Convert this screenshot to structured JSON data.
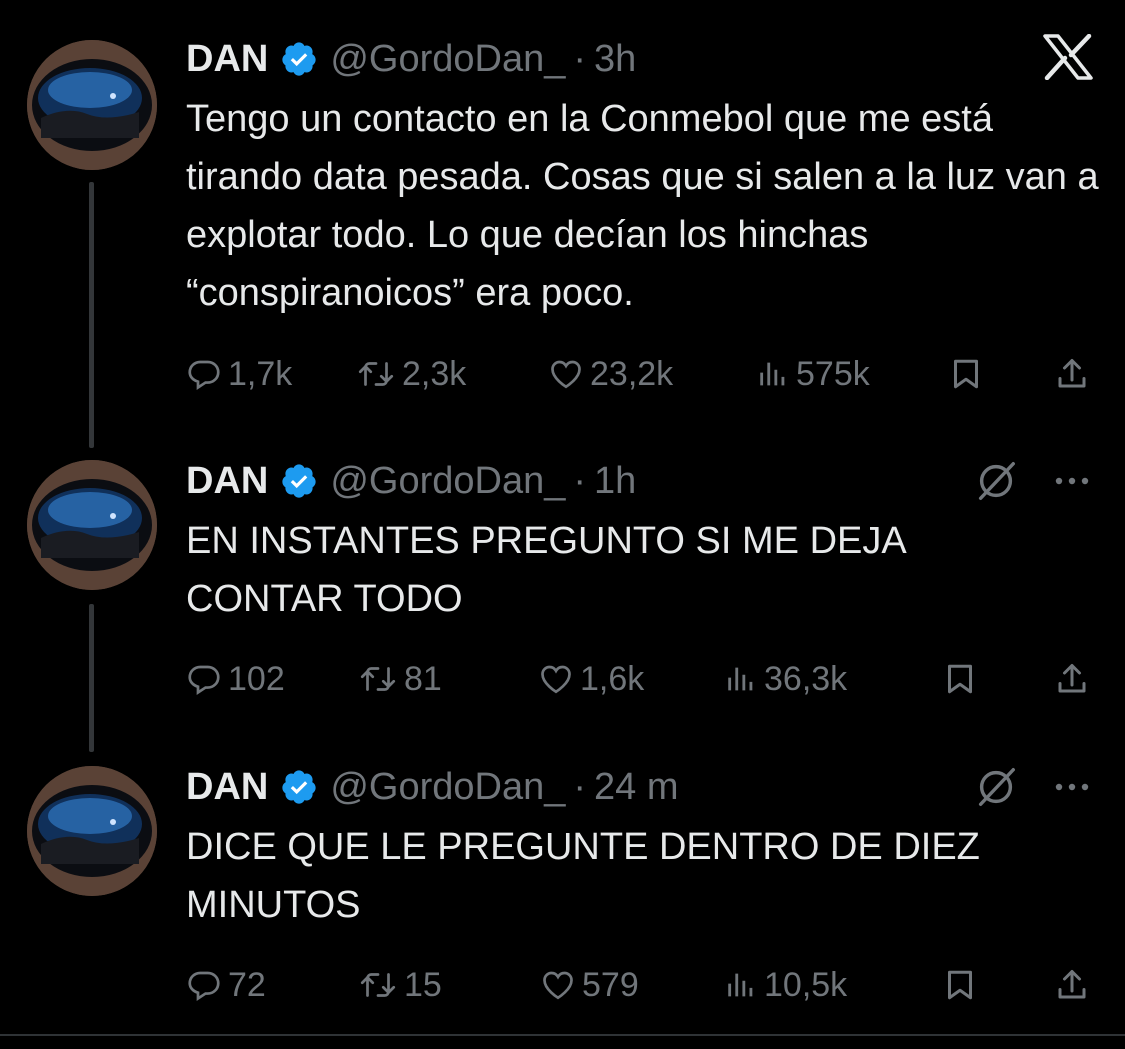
{
  "tweets": [
    {
      "name": "DAN",
      "handle": "@GordoDan_",
      "dot": "·",
      "time": "3h",
      "text": "Tengo un contacto en la Conmebol que me está tirando data pesada. Cosas que si salen a la luz van a explotar todo. Lo que decían los hinchas “conspiranoicos” era poco.",
      "replies": "1,7k",
      "retweets": "2,3k",
      "likes": "23,2k",
      "views": "575k"
    },
    {
      "name": "DAN",
      "handle": "@GordoDan_",
      "dot": "·",
      "time": "1h",
      "text": "EN INSTANTES PREGUNTO SI ME DEJA CONTAR TODO",
      "replies": "102",
      "retweets": "81",
      "likes": "1,6k",
      "views": "36,3k"
    },
    {
      "name": "DAN",
      "handle": "@GordoDan_",
      "dot": "·",
      "time": "24 m",
      "text": "DICE QUE LE PREGUNTE DENTRO DE DIEZ MINUTOS",
      "replies": "72",
      "retweets": "15",
      "likes": "579",
      "views": "10,5k"
    }
  ],
  "icons": {
    "brand": "x-logo-icon",
    "verified": "verified-badge-icon",
    "grok": "grok-icon",
    "more": "more-icon",
    "reply": "reply-icon",
    "retweet": "retweet-icon",
    "like": "like-icon",
    "views": "views-icon",
    "bookmark": "bookmark-icon",
    "share": "share-icon"
  },
  "colors": {
    "background": "#000000",
    "text": "#e7e9ea",
    "secondary": "#71767b",
    "verified": "#1d9bf0",
    "thread_line": "#333639"
  }
}
